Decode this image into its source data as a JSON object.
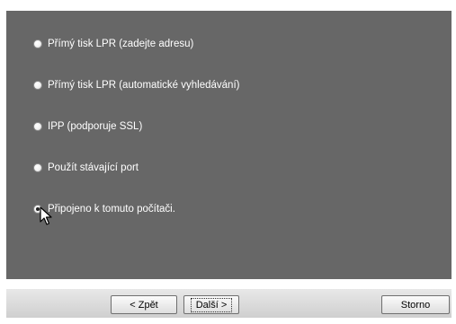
{
  "options": [
    {
      "label": "Přímý tisk LPR (zadejte adresu)",
      "checked": false
    },
    {
      "label": "Přímý tisk LPR (automatické vyhledávání)",
      "checked": false
    },
    {
      "label": "IPP (podporuje SSL)",
      "checked": false
    },
    {
      "label": "Použít stávající port",
      "checked": false
    },
    {
      "label": "Připojeno k tomuto počítači.",
      "checked": true
    }
  ],
  "buttons": {
    "back_label": "< Zpět",
    "next_label": "Další >",
    "cancel_label": "Storno"
  },
  "colors": {
    "panel_background": "#676767",
    "button_bar": "#d9d9d9",
    "option_text": "#ffffff"
  },
  "icons": {
    "cursor": "mouse-pointer-icon"
  }
}
